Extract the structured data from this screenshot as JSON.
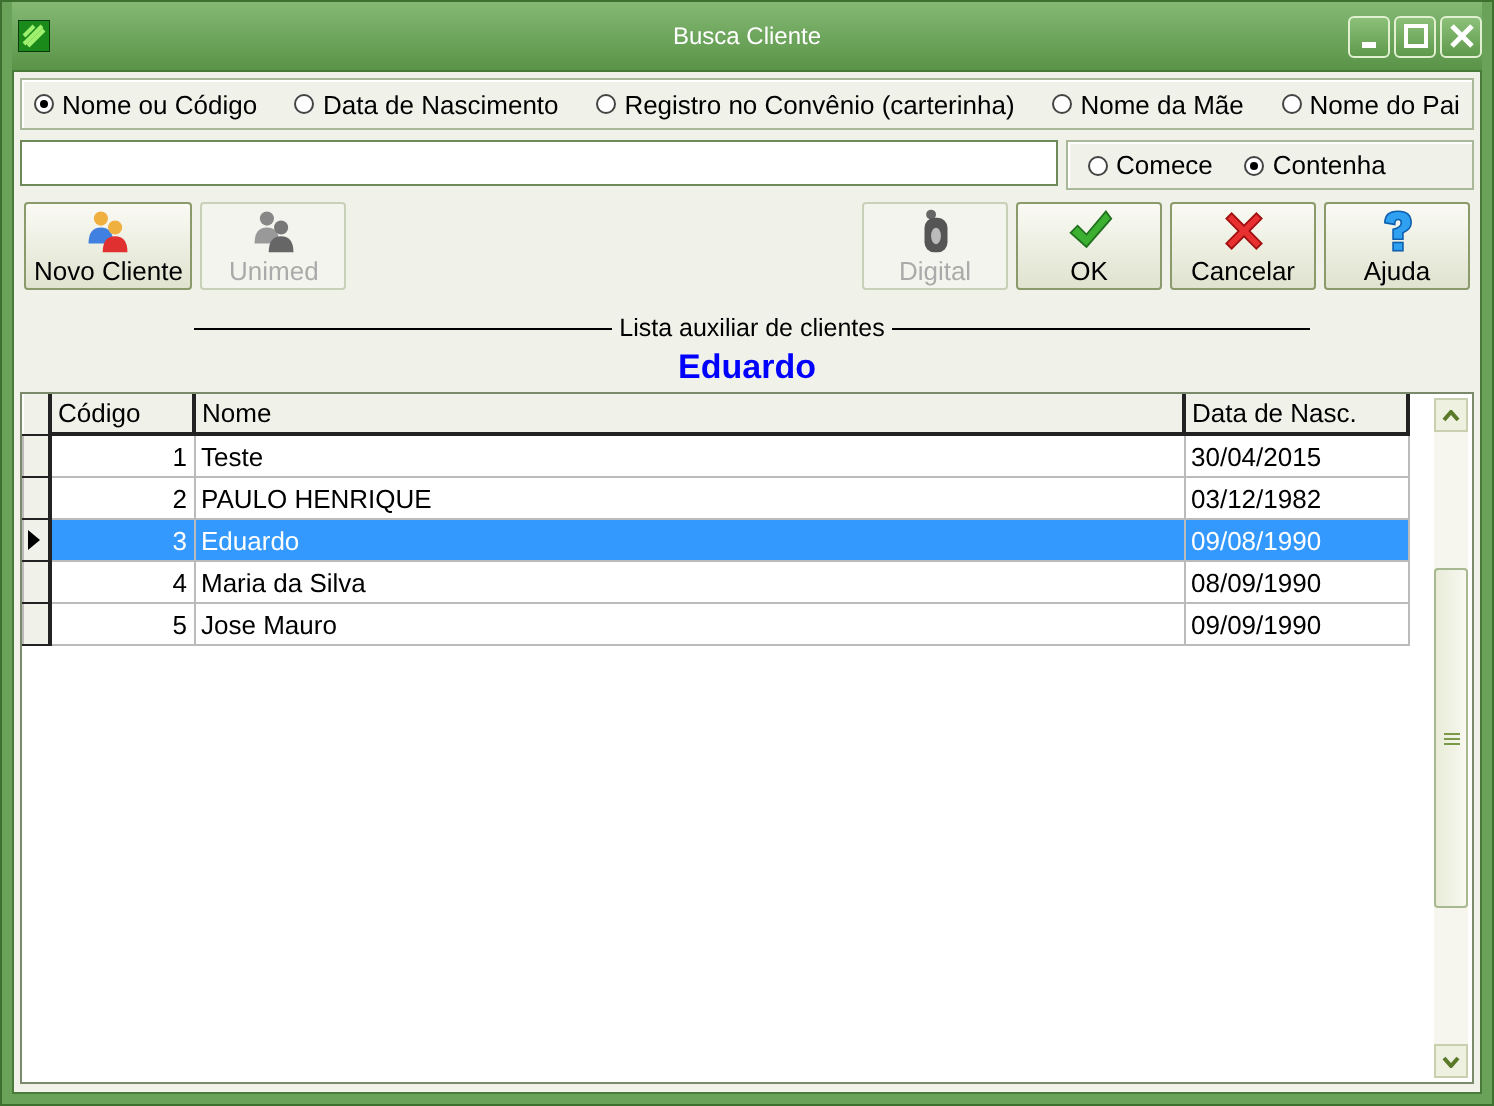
{
  "window": {
    "title": "Busca Cliente"
  },
  "search_by": [
    {
      "label": "Nome ou Código",
      "selected": true
    },
    {
      "label": "Data de Nascimento",
      "selected": false
    },
    {
      "label": "Registro no Convênio (carterinha)",
      "selected": false
    },
    {
      "label": "Nome da Mãe",
      "selected": false
    },
    {
      "label": "Nome do Pai",
      "selected": false
    }
  ],
  "match": [
    {
      "label": "Comece",
      "selected": false
    },
    {
      "label": "Contenha",
      "selected": true
    }
  ],
  "buttons_left": [
    {
      "label": "Novo Cliente",
      "kind": "people",
      "disabled": false
    },
    {
      "label": "Unimed",
      "kind": "people",
      "disabled": true
    }
  ],
  "buttons_right": [
    {
      "label": "Digital",
      "kind": "fingerprint",
      "disabled": true
    },
    {
      "label": "OK",
      "kind": "check",
      "disabled": false
    },
    {
      "label": "Cancelar",
      "kind": "cross",
      "disabled": false
    },
    {
      "label": "Ajuda",
      "kind": "question",
      "disabled": false
    }
  ],
  "list_title": "Lista auxiliar de clientes",
  "selected_name": "Eduardo",
  "table": {
    "columns": [
      "Código",
      "Nome",
      "Data de Nasc."
    ],
    "rows": [
      {
        "cells": [
          "1",
          "Teste",
          "30/04/2015"
        ],
        "selected": false
      },
      {
        "cells": [
          "2",
          "PAULO HENRIQUE",
          "03/12/1982"
        ],
        "selected": false
      },
      {
        "cells": [
          "3",
          "Eduardo",
          "09/08/1990"
        ],
        "selected": true
      },
      {
        "cells": [
          "4",
          "Maria da Silva",
          "08/09/1990"
        ],
        "selected": false
      },
      {
        "cells": [
          "5",
          "Jose Mauro",
          "09/09/1990"
        ],
        "selected": false
      }
    ]
  }
}
